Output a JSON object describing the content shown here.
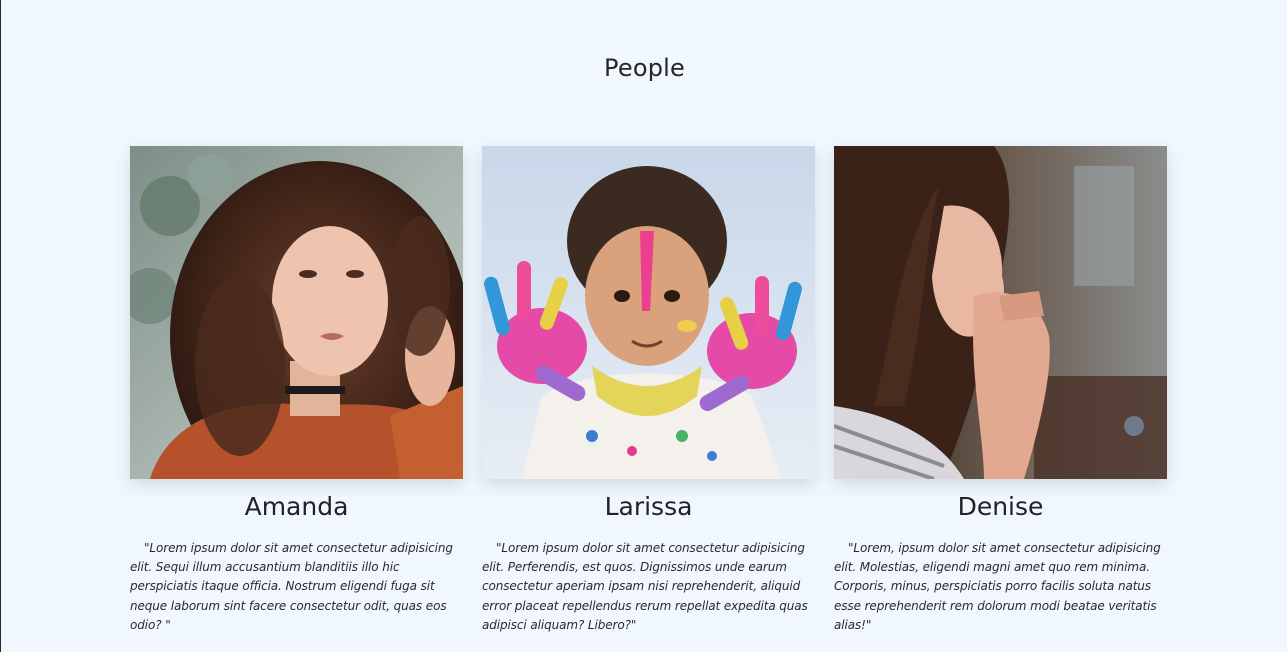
{
  "section": {
    "title": "People"
  },
  "people": [
    {
      "name": "Amanda",
      "quote": "\"Lorem ipsum dolor sit amet consectetur adipisicing elit. Sequi illum accusantium blanditiis illo hic perspiciatis itaque officia. Nostrum eligendi fuga sit neque laborum sint facere consectetur odit, quas eos odio? \""
    },
    {
      "name": "Larissa",
      "quote": "\"Lorem ipsum dolor sit amet consectetur adipisicing elit. Perferendis, est quos. Dignissimos unde earum consectetur aperiam ipsam nisi reprehenderit, aliquid error placeat repellendus rerum repellat expedita quas adipisci aliquam? Libero?\""
    },
    {
      "name": "Denise",
      "quote": "\"Lorem, ipsum dolor sit amet consectetur adipisicing elit. Molestias, eligendi magni amet quo rem minima. Corporis, minus, perspiciatis porro facilis soluta natus esse reprehenderit rem dolorum modi beatae veritatis alias!\""
    }
  ],
  "colors": {
    "background": "#f0f7ff",
    "text": "#222222"
  }
}
